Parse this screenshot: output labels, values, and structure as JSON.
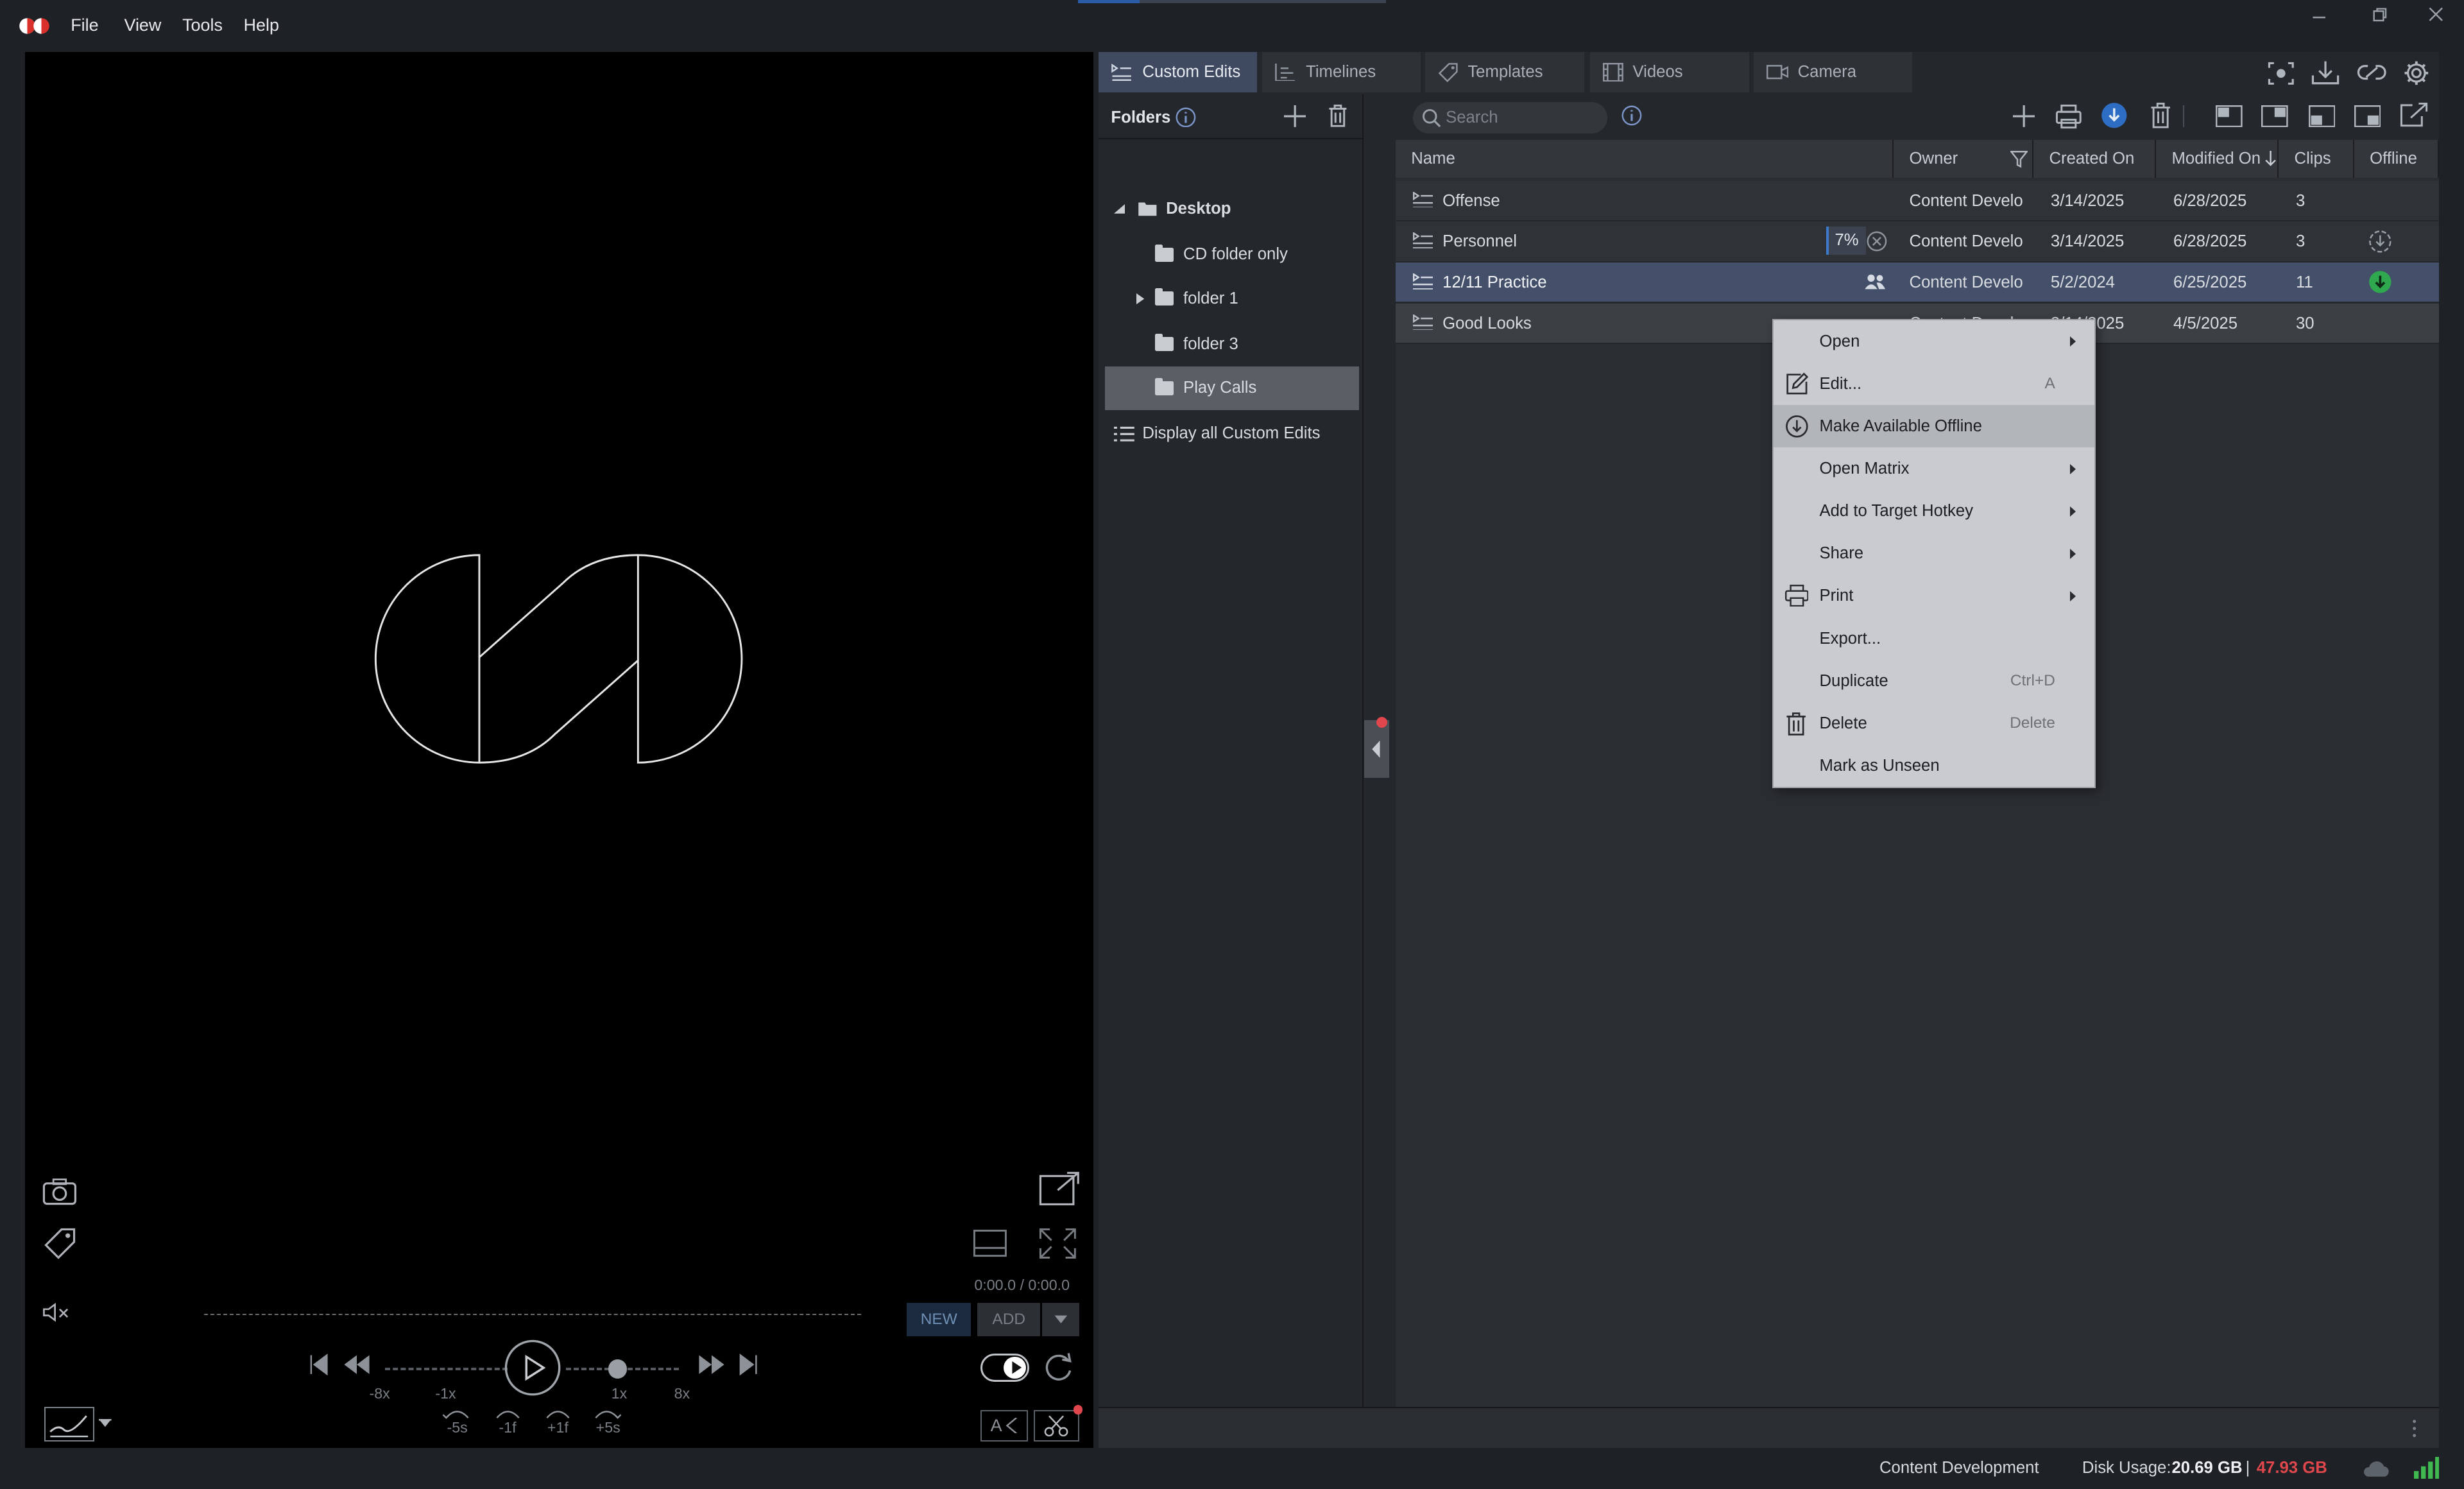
{
  "menubar": {
    "items": [
      "File",
      "View",
      "Tools",
      "Help"
    ]
  },
  "player": {
    "timecode_current": "0:00.0",
    "timecode_total": "/ 0:00.0",
    "new_label": "NEW",
    "add_label": "ADD",
    "speed_labels": [
      "-8x",
      "-1x",
      "1x",
      "8x"
    ],
    "step_labels": [
      "-5s",
      "-1f",
      "+1f",
      "+5s"
    ],
    "text_tool_label": "A"
  },
  "tabs": [
    {
      "label": "Custom Edits",
      "icon": "custom-edits-icon",
      "active": true
    },
    {
      "label": "Timelines",
      "icon": "timelines-icon"
    },
    {
      "label": "Templates",
      "icon": "tag-icon"
    },
    {
      "label": "Videos",
      "icon": "film-icon"
    },
    {
      "label": "Camera",
      "icon": "camera-icon"
    }
  ],
  "folders": {
    "title": "Folders",
    "items": [
      {
        "label": "Desktop",
        "level": 0,
        "expanded": true
      },
      {
        "label": "CD folder only",
        "level": 1
      },
      {
        "label": "folder 1",
        "level": 1,
        "collapsed": true
      },
      {
        "label": "folder 3",
        "level": 1
      },
      {
        "label": "Play Calls",
        "level": 1,
        "selected": true
      }
    ],
    "display_all": "Display all Custom Edits"
  },
  "search": {
    "placeholder": "Search"
  },
  "table": {
    "columns": [
      "Name",
      "Owner",
      "Created On",
      "Modified On",
      "Clips",
      "Offline"
    ],
    "rows": [
      {
        "name": "Offense",
        "owner": "Content Development",
        "created": "3/14/2025",
        "modified": "6/28/2025",
        "clips": "3"
      },
      {
        "name": "Personnel",
        "owner": "Content Development",
        "created": "3/14/2025",
        "modified": "6/28/2025",
        "clips": "3",
        "progress": "7%",
        "offline": "download-pending"
      },
      {
        "name": "12/11 Practice",
        "owner": "Content Development",
        "created": "5/2/2024",
        "modified": "6/25/2025",
        "clips": "11",
        "shared": true,
        "offline": "available",
        "selected": true
      },
      {
        "name": "Good Looks",
        "owner": "Content Development",
        "created": "3/14/2025",
        "modified": "4/5/2025",
        "clips": "30"
      }
    ]
  },
  "context_menu": {
    "items": [
      {
        "label": "Open",
        "submenu": true
      },
      {
        "label": "Edit...",
        "shortcut": "A",
        "icon": "edit-icon"
      },
      {
        "label": "Make Available Offline",
        "icon": "download-icon",
        "highlighted": true
      },
      {
        "label": "Open Matrix",
        "submenu": true
      },
      {
        "label": "Add to Target Hotkey",
        "submenu": true
      },
      {
        "label": "Share",
        "submenu": true
      },
      {
        "label": "Print",
        "submenu": true,
        "icon": "printer-icon"
      },
      {
        "label": "Export..."
      },
      {
        "label": "Duplicate",
        "shortcut": "Ctrl+D"
      },
      {
        "label": "Delete",
        "shortcut": "Delete",
        "icon": "trash-icon"
      },
      {
        "label": "Mark as Unseen"
      }
    ]
  },
  "statusbar": {
    "user": "Content Development",
    "disk_label": "Disk Usage:",
    "disk_used": "20.69 GB",
    "separator": "|",
    "disk_total": "47.93 GB"
  },
  "colors": {
    "accent": "#3f4a60",
    "selected_row": "#44506a",
    "offline_green": "#2fa84f",
    "disk_total_red": "#e0474c",
    "signal_green": "#3fb950"
  }
}
